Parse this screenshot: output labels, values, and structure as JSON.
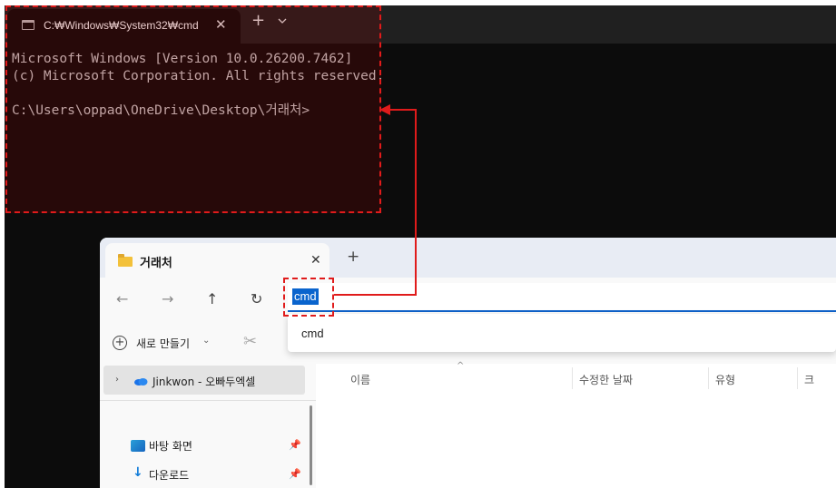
{
  "terminal": {
    "tab_title": "C:₩Windows₩System32₩cmd",
    "close_glyph": "✕",
    "new_tab_glyph": "+",
    "dropdown_icon": "chevron-down-icon",
    "lines": [
      "Microsoft Windows [Version 10.0.26200.7462]",
      "(c) Microsoft Corporation. All rights reserved.",
      "",
      "C:\\Users\\oppad\\OneDrive\\Desktop\\거래처>"
    ]
  },
  "explorer": {
    "tab_title": "거래처",
    "close_glyph": "✕",
    "new_tab_glyph": "+",
    "nav": {
      "back_glyph": "←",
      "forward_glyph": "→",
      "up_glyph": "↑",
      "refresh_glyph": "↻"
    },
    "address_value": "cmd",
    "suggestion": "cmd",
    "toolbar": {
      "new_icon_glyph": "+",
      "new_label": "새로 만들기",
      "new_caret": "⌄",
      "cut_glyph": "✂"
    },
    "sidebar": {
      "chevron": "›",
      "cloud_label": "Jinkwon - 오빠두엑셀",
      "items": [
        {
          "label": "바탕 화면",
          "icon": "desktop-icon",
          "pin": "📌"
        },
        {
          "label": "다운로드",
          "icon": "download-icon",
          "pin": "📌"
        }
      ],
      "download_glyph": "↓"
    },
    "columns": [
      "이름",
      "수정한 날짜",
      "유형",
      "크"
    ],
    "sort_caret": "^"
  },
  "colors": {
    "highlight": "#e01b1b",
    "selection": "#0a64cd",
    "terminal_bg": "#0c0c0c",
    "accent": "#0f62c9"
  }
}
